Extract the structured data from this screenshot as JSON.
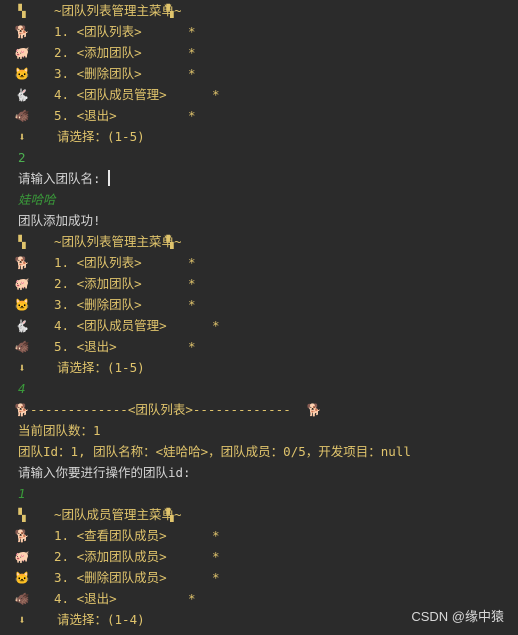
{
  "console": {
    "lines": [
      {
        "kind": "menu",
        "icon": "flag-icon",
        "icon_glyph": "▚",
        "text": "~团队列表管理主菜单~",
        "trail_icon": "flag-icon",
        "trail_glyph": "▚"
      },
      {
        "kind": "menu",
        "icon": "dog-icon",
        "icon_glyph": "🐕",
        "text": "1. <团队列表>",
        "star": "*"
      },
      {
        "kind": "menu",
        "icon": "pig-icon",
        "icon_glyph": "🐖",
        "text": "2. <添加团队>",
        "star": "*"
      },
      {
        "kind": "menu",
        "icon": "cat-icon",
        "icon_glyph": "🐱",
        "text": "3. <删除团队>",
        "star": "*"
      },
      {
        "kind": "menu",
        "icon": "rabbit-icon",
        "icon_glyph": "🐇",
        "text": "4. <团队成员管理>",
        "star": "*"
      },
      {
        "kind": "menu",
        "icon": "boar-icon",
        "icon_glyph": "🐗",
        "text": "5. <退出>",
        "star": "*"
      },
      {
        "kind": "prompt",
        "icon": "down-arrow-icon",
        "icon_glyph": "⬇",
        "text": "请选择：(1-5)"
      },
      {
        "kind": "input",
        "text": "2"
      },
      {
        "kind": "out",
        "text": "请输入团队名:",
        "cursor": true
      },
      {
        "kind": "input-it",
        "text": "娃哈哈"
      },
      {
        "kind": "out",
        "text": "团队添加成功!"
      },
      {
        "kind": "menu",
        "icon": "flag-icon",
        "icon_glyph": "▚",
        "text": "~团队列表管理主菜单~",
        "trail_icon": "flag-icon",
        "trail_glyph": "▚"
      },
      {
        "kind": "menu",
        "icon": "dog-icon",
        "icon_glyph": "🐕",
        "text": "1. <团队列表>",
        "star": "*"
      },
      {
        "kind": "menu",
        "icon": "pig-icon",
        "icon_glyph": "🐖",
        "text": "2. <添加团队>",
        "star": "*"
      },
      {
        "kind": "menu",
        "icon": "cat-icon",
        "icon_glyph": "🐱",
        "text": "3. <删除团队>",
        "star": "*"
      },
      {
        "kind": "menu",
        "icon": "rabbit-icon",
        "icon_glyph": "🐇",
        "text": "4. <团队成员管理>",
        "star": "*"
      },
      {
        "kind": "menu",
        "icon": "boar-icon",
        "icon_glyph": "🐗",
        "text": "5. <退出>",
        "star": "*"
      },
      {
        "kind": "prompt",
        "icon": "down-arrow-icon",
        "icon_glyph": "⬇",
        "text": "请选择：(1-5)"
      },
      {
        "kind": "input-it",
        "text": "4"
      },
      {
        "kind": "divider",
        "icon": "dog-icon",
        "icon_glyph": "🐕",
        "text": "-------------<团队列表>-------------",
        "trail_icon": "dog-icon",
        "trail_glyph": "🐕"
      },
      {
        "kind": "menu-text",
        "text": "当前团队数：1"
      },
      {
        "kind": "menu-text",
        "text": "团队Id：1, 团队名称：<娃哈哈>，团队成员：0/5，开发项目：null"
      },
      {
        "kind": "out",
        "text": "请输入你要进行操作的团队id:"
      },
      {
        "kind": "input-it",
        "text": "1"
      },
      {
        "kind": "menu",
        "icon": "flag-icon",
        "icon_glyph": "▚",
        "text": "~团队成员管理主菜单~",
        "trail_icon": "flag-icon",
        "trail_glyph": "▚"
      },
      {
        "kind": "menu",
        "icon": "dog-icon",
        "icon_glyph": "🐕",
        "text": "1. <查看团队成员>",
        "star": "*"
      },
      {
        "kind": "menu",
        "icon": "pig-icon",
        "icon_glyph": "🐖",
        "text": "2. <添加团队成员>",
        "star": "*"
      },
      {
        "kind": "menu",
        "icon": "cat-icon",
        "icon_glyph": "🐱",
        "text": "3. <删除团队成员>",
        "star": "*"
      },
      {
        "kind": "menu",
        "icon": "boar-icon",
        "icon_glyph": "🐗",
        "text": "4. <退出>",
        "star": "*"
      },
      {
        "kind": "prompt",
        "icon": "down-arrow-icon",
        "icon_glyph": "⬇",
        "text": "请选择：(1-4)"
      }
    ]
  },
  "watermark": "CSDN @缘中猿",
  "colors": {
    "background": "#2b2b2b",
    "output_text": "#d4d4d4",
    "menu_text": "#e0c46c",
    "user_input": "#4caf50"
  }
}
